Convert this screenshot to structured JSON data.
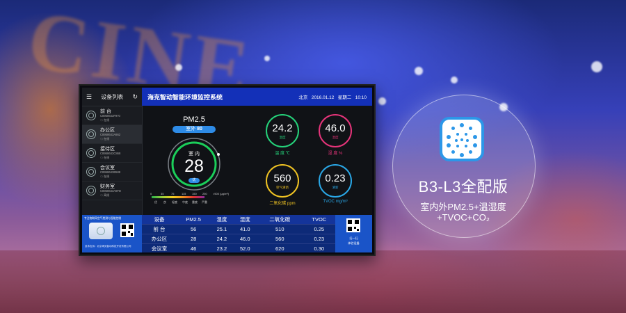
{
  "sidebar": {
    "title": "设备列表",
    "devices": [
      {
        "name": "前  台",
        "id": "C8958643F970",
        "status": "在线"
      },
      {
        "name": "办公区",
        "id": "C8958643A862",
        "status": "在线"
      },
      {
        "name": "接待区",
        "id": "C8958643C868",
        "status": "在线"
      },
      {
        "name": "会议室",
        "id": "C8958643B588",
        "status": "在线"
      },
      {
        "name": "财务室",
        "id": "C8958643A8FD",
        "status": "离线"
      }
    ]
  },
  "header": {
    "title": "海克智动智能环境监控系统",
    "city": "北京",
    "date": "2016.01.12",
    "weekday": "星期二",
    "time": "10:10"
  },
  "pm": {
    "title": "PM2.5",
    "outdoor_label": "室外",
    "outdoor_value": "80",
    "indoor_label": "室 内",
    "indoor_value": "28",
    "grade": "优",
    "scale_numbers": [
      "0",
      "35",
      "75",
      "115",
      "150",
      "250",
      ">500 (μg/m³)"
    ],
    "scale_labels": [
      "优",
      "良",
      "轻度",
      "中度",
      "重度",
      "严重"
    ]
  },
  "metrics": {
    "temperature": {
      "value": "24.2",
      "unit": "温度",
      "label": "温 度 ℃",
      "color": "#25d27a"
    },
    "humidity": {
      "value": "46.0",
      "unit": "湿度",
      "label": "湿 度 %",
      "color": "#e6347a"
    },
    "co2": {
      "value": "560",
      "unit": "空气清新",
      "label": "二氧化碳 ppm",
      "color": "#f0c323"
    },
    "tvoc": {
      "value": "0.23",
      "unit": "清新",
      "label": "TVOC mg/m³",
      "color": "#2aa7e6"
    }
  },
  "table": {
    "headers": [
      "设备",
      "PM2.5",
      "温度",
      "湿度",
      "二氧化碳",
      "TVOC"
    ],
    "rows": [
      [
        "前  台",
        "56",
        "25.1",
        "41.0",
        "510",
        "0.25"
      ],
      [
        "办公区",
        "28",
        "24.2",
        "46.0",
        "560",
        "0.23"
      ],
      [
        "会议室",
        "46",
        "23.2",
        "52.0",
        "620",
        "0.30"
      ]
    ]
  },
  "promo": {
    "slogan": "专注物联网空气检测与智能控制",
    "footer": "技术支持：北京海克智动科技开发有限公司"
  },
  "qr": {
    "line1": "扫一扫",
    "line2": "体验设备"
  },
  "product": {
    "model": "B3-L3全配版",
    "feature1": "室内外PM2.5+温湿度",
    "feature2": "+TVOC+CO₂"
  }
}
